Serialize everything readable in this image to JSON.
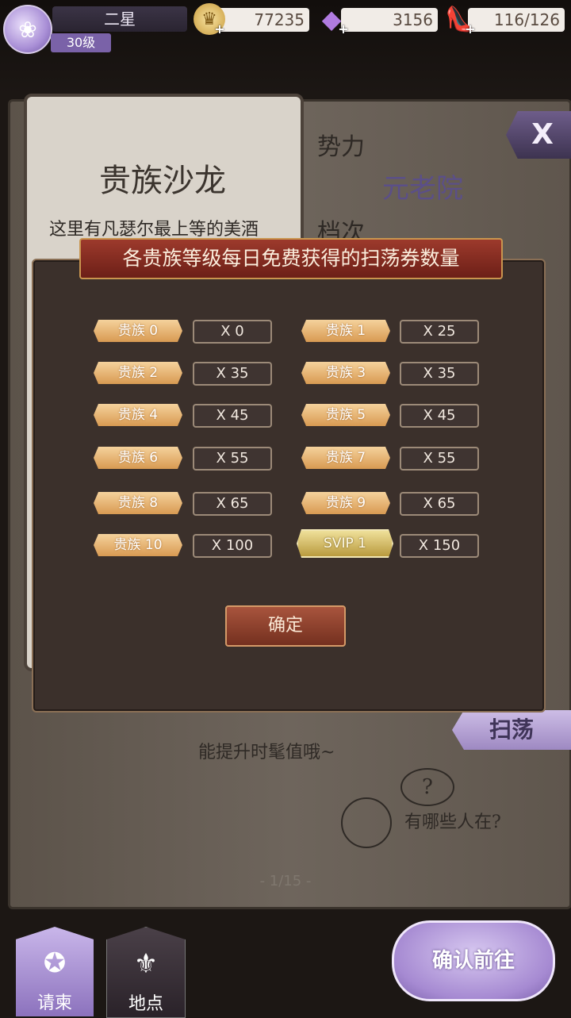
{
  "header": {
    "player_name": "二星",
    "level": "30级",
    "gold": "77235",
    "gems": "3156",
    "stamina": "116/126"
  },
  "background": {
    "salon_title": "贵族沙龙",
    "salon_desc": "这里有凡瑟尔最上等的美酒",
    "faction_label": "势力",
    "faction_value": "元老院",
    "grade_label": "档次",
    "hint_line": "能提升时髦值哦~",
    "question": "?",
    "who_here": "有哪些人在?",
    "sweep_label": "扫荡",
    "close_label": "X",
    "pager": "- 1/15 -"
  },
  "dialog": {
    "title": "各贵族等级每日免费获得的扫荡券数量",
    "rows": [
      {
        "left_tag": "贵族 0",
        "left_val": "X 0",
        "right_tag": "贵族 1",
        "right_val": "X 25"
      },
      {
        "left_tag": "贵族 2",
        "left_val": "X 35",
        "right_tag": "贵族 3",
        "right_val": "X 35"
      },
      {
        "left_tag": "贵族 4",
        "left_val": "X 45",
        "right_tag": "贵族 5",
        "right_val": "X 45"
      },
      {
        "left_tag": "贵族 6",
        "left_val": "X 55",
        "right_tag": "贵族 7",
        "right_val": "X 55"
      },
      {
        "left_tag": "贵族 8",
        "left_val": "X 65",
        "right_tag": "贵族 9",
        "right_val": "X 65"
      },
      {
        "left_tag": "贵族 10",
        "left_val": "X 100",
        "right_tag": "SVIP 1",
        "right_val": "X 150"
      }
    ],
    "confirm_label": "确定"
  },
  "nav": {
    "invite_label": "请柬",
    "location_label": "地点",
    "go_label": "确认前往"
  }
}
